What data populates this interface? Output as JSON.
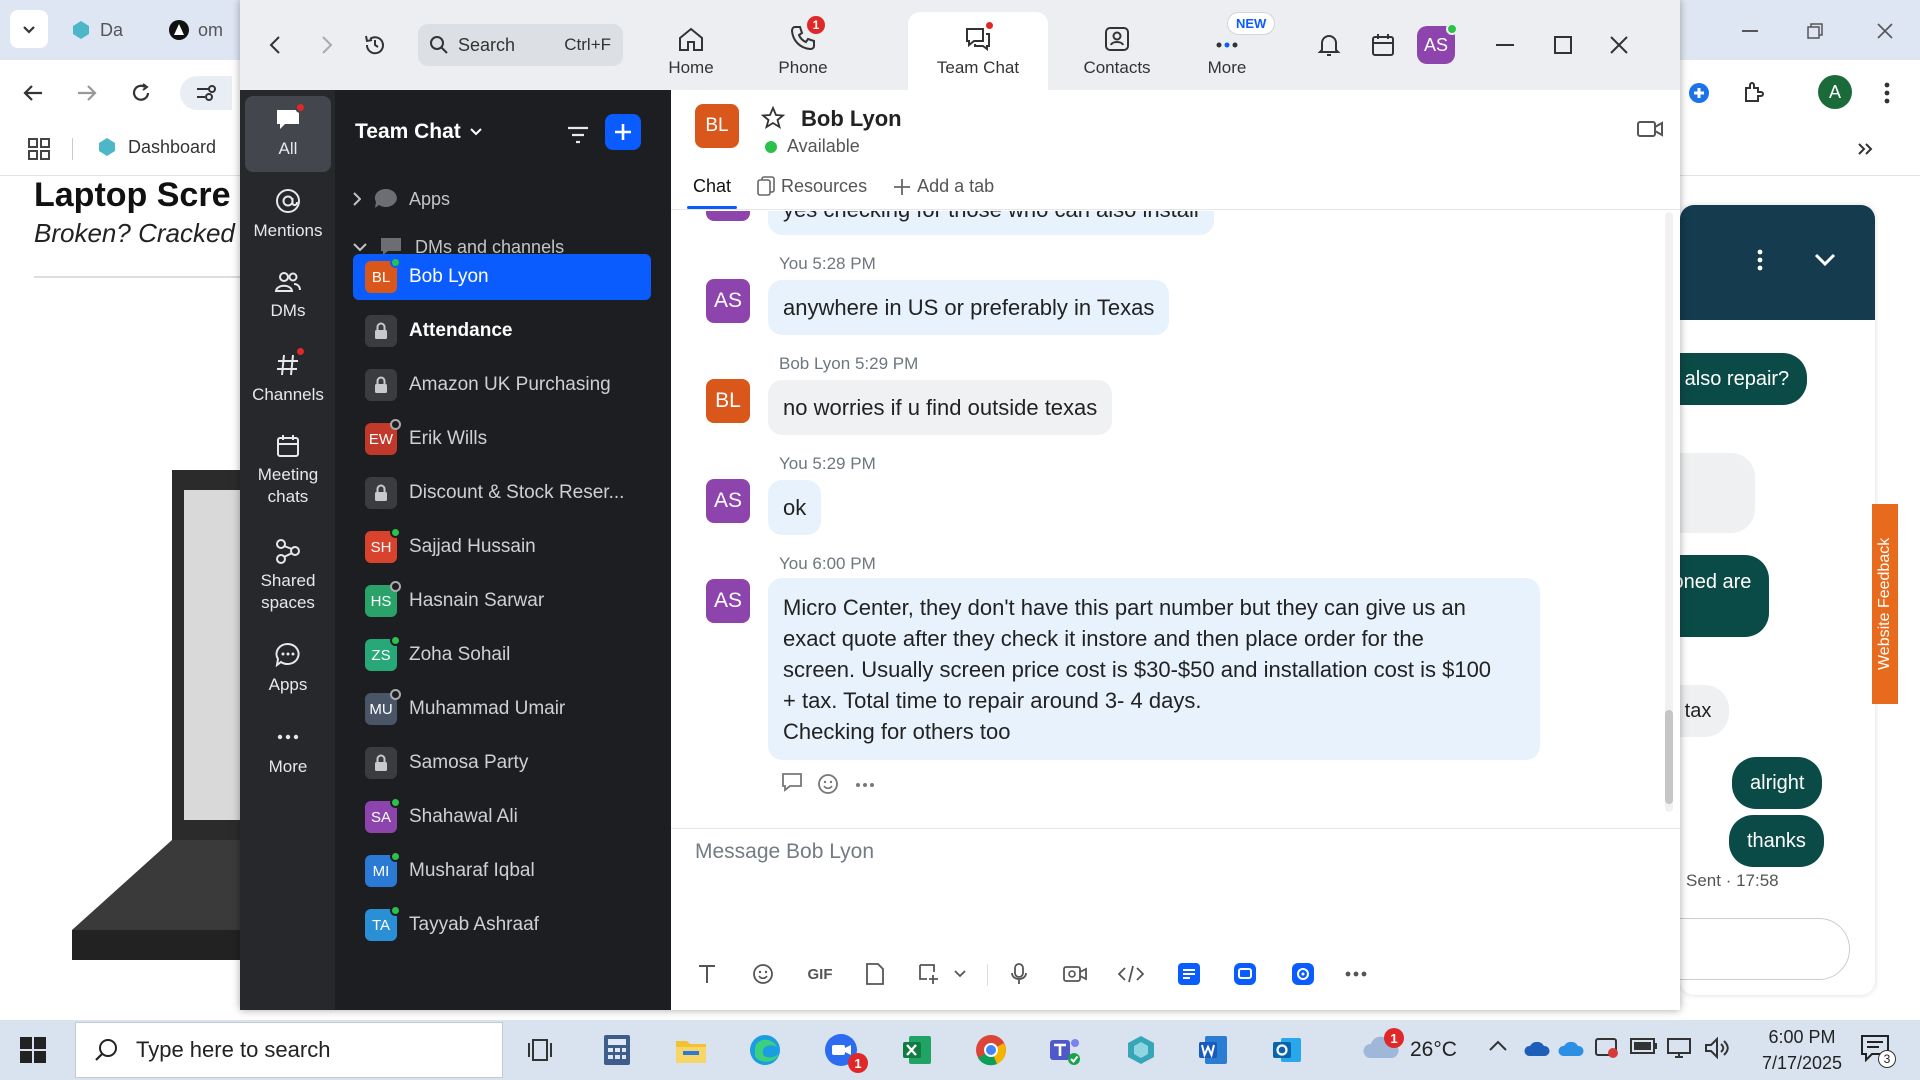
{
  "browser": {
    "tabs": [
      {
        "label": "Da"
      },
      {
        "label": "om"
      }
    ],
    "bookmarks": [
      {
        "label": "Dashboard"
      }
    ],
    "profile_initial": "A",
    "page": {
      "heading": "Laptop Scre",
      "subheading": "Broken? Cracked"
    },
    "chat_widget": {
      "messages": [
        {
          "text": "d also repair?",
          "style": "dark"
        },
        {
          "text": "ioned are",
          "text2": "?",
          "style": "dark"
        },
        {
          "text": "e tax",
          "style": "light"
        },
        {
          "text": "alright",
          "style": "dark"
        },
        {
          "text": "thanks",
          "style": "dark"
        }
      ],
      "sent_status": "Sent · 17:58",
      "feedback_tab": "Website Feedback"
    }
  },
  "zoom": {
    "search": {
      "placeholder": "Search",
      "shortcut": "Ctrl+F"
    },
    "nav_tabs": [
      {
        "label": "Home"
      },
      {
        "label": "Phone",
        "badge": "1"
      },
      {
        "label": "Team Chat"
      },
      {
        "label": "Contacts"
      },
      {
        "label": "More",
        "tag": "NEW"
      }
    ],
    "user_initials": "AS",
    "rail": [
      {
        "label": "All"
      },
      {
        "label": "Mentions"
      },
      {
        "label": "DMs"
      },
      {
        "label": "Channels"
      },
      {
        "label": "Meeting chats"
      },
      {
        "label": "Shared spaces"
      },
      {
        "label": "Apps"
      },
      {
        "label": "More"
      }
    ],
    "channel_list": {
      "title": "Team Chat",
      "sections": [
        {
          "label": "Apps"
        },
        {
          "label": "DMs and channels"
        }
      ],
      "items": [
        {
          "label": "Bob Lyon",
          "initials": "BL",
          "color": "#d9571a",
          "presence": "on"
        },
        {
          "label": "Attendance",
          "initials": "",
          "color": "",
          "presence": ""
        },
        {
          "label": "Amazon UK Purchasing",
          "initials": "",
          "color": "",
          "presence": ""
        },
        {
          "label": "Erik Wills",
          "initials": "EW",
          "color": "#c0392b",
          "presence": "off"
        },
        {
          "label": "Discount & Stock Reser...",
          "initials": "",
          "color": "",
          "presence": ""
        },
        {
          "label": "Sajjad Hussain",
          "initials": "SH",
          "color": "#d9432e",
          "presence": "on"
        },
        {
          "label": "Hasnain Sarwar",
          "initials": "HS",
          "color": "#2aa36b",
          "presence": "off"
        },
        {
          "label": "Zoha Sohail",
          "initials": "ZS",
          "color": "#28a879",
          "presence": "on"
        },
        {
          "label": "Muhammad Umair",
          "initials": "MU",
          "color": "#4a5568",
          "presence": "off"
        },
        {
          "label": "Samosa Party",
          "initials": "",
          "color": "",
          "presence": ""
        },
        {
          "label": "Shahawal Ali",
          "initials": "SA",
          "color": "#8e44ad",
          "presence": "on"
        },
        {
          "label": "Musharaf Iqbal",
          "initials": "MI",
          "color": "#2b7bd6",
          "presence": "on"
        },
        {
          "label": "Tayyab Ashraaf",
          "initials": "TA",
          "color": "#2b8fd6",
          "presence": "on"
        }
      ]
    },
    "conversation": {
      "name": "Bob Lyon",
      "initials": "BL",
      "status": "Available",
      "tabs": [
        {
          "label": "Chat"
        },
        {
          "label": "Resources"
        },
        {
          "label": "Add a tab"
        }
      ],
      "partial_message": "yes checking for those who can also install",
      "messages": [
        {
          "sender": "You",
          "time": "5:28 PM",
          "initials": "AS",
          "lines": [
            "anywhere in US or preferably in Texas"
          ]
        },
        {
          "sender": "Bob Lyon",
          "time": "5:29 PM",
          "initials": "BL",
          "lines": [
            "no worries if u find outside texas"
          ]
        },
        {
          "sender": "You",
          "time": "5:29 PM",
          "initials": "AS",
          "lines": [
            "ok"
          ]
        },
        {
          "sender": "You",
          "time": "6:00 PM",
          "initials": "AS",
          "lines": [
            "Micro Center, they don't have this part number but they can give us an",
            "exact quote after they check it instore and then place order for the",
            "screen. Usually screen price cost is $30-$50 and installation cost is $100",
            "+ tax. Total time to repair around 3- 4 days.",
            "Checking for others too"
          ]
        }
      ],
      "composer_placeholder": "Message Bob Lyon"
    }
  },
  "taskbar": {
    "search_placeholder": "Type here to search",
    "weather": "26°C",
    "time": "6:00 PM",
    "date": "7/17/2025",
    "notification_count": "3",
    "zoom_badge": "1",
    "weather_badge": "1"
  },
  "colors": {
    "zoom_blue": "#0b5cff",
    "avatar_as": "#8e44ad",
    "avatar_bl": "#d9571a",
    "bubble": "#e8f2fd"
  }
}
